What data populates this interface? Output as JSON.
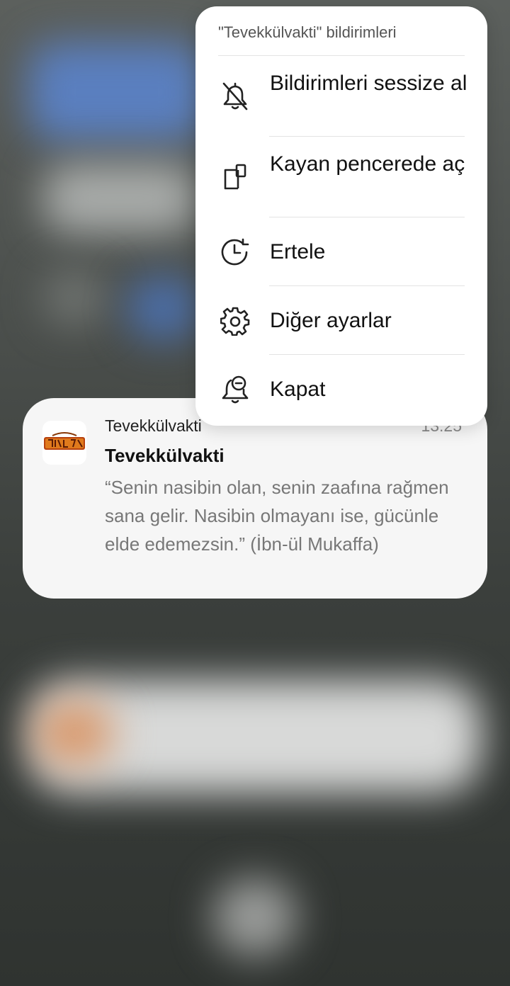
{
  "notification_menu": {
    "header": "\"Tevekkülvakti\" bildirimleri",
    "items": [
      {
        "label": "Bildirimleri sessize al",
        "icon": "bell-off-icon"
      },
      {
        "label": "Kayan pencerede aç",
        "icon": "floating-window-icon"
      },
      {
        "label": "Ertele",
        "icon": "snooze-clock-icon"
      },
      {
        "label": "Diğer ayarlar",
        "icon": "gear-icon"
      },
      {
        "label": "Kapat",
        "icon": "bell-minus-icon"
      }
    ]
  },
  "notification": {
    "app_name": "Tevekkülvakti",
    "time": "13:25",
    "title": "Tevekkülvakti",
    "body": "“Senin nasibin olan, senin zaafına rağmen sana gelir. Nasibin olmayanı ise, gücünle elde edemezsin.” (İbn-ül Mukaffa)",
    "icon": "app-logo-icon"
  },
  "colors": {
    "menu_bg": "#ffffff",
    "card_bg": "#f6f6f6",
    "body_text": "#777777"
  }
}
